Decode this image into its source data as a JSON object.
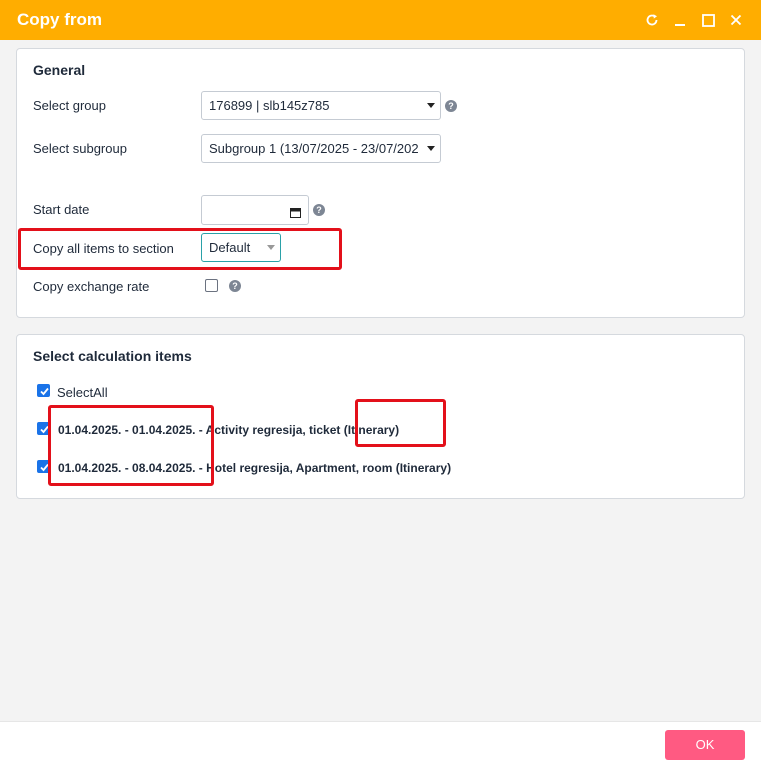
{
  "window": {
    "title": "Copy from",
    "controls": [
      "refresh-icon",
      "minimize-icon",
      "maximize-icon",
      "close-icon"
    ]
  },
  "general": {
    "heading": "General",
    "group_label": "Select group",
    "group_value": "176899 | slb145z785",
    "subgroup_label": "Select subgroup",
    "subgroup_value": "Subgroup 1 (13/07/2025 - 23/07/202",
    "start_date_label": "Start date",
    "start_date_value": "",
    "section_label": "Copy all items to section",
    "section_value": "Default",
    "exchange_label": "Copy exchange rate",
    "exchange_checked": false
  },
  "calc": {
    "heading": "Select calculation items",
    "select_all_label": "SelectAll",
    "select_all_checked": true,
    "items": [
      {
        "dates": "01.04.2025. - 01.04.2025.",
        "rest": " - Activity regresija, ticket",
        "suffix": " (Itinerary)",
        "checked": true
      },
      {
        "dates": "01.04.2025. - 08.04.2025.",
        "rest": " - Hotel regresija, Apartment, room (Itinerary)",
        "suffix": "",
        "checked": true
      }
    ]
  },
  "footer": {
    "ok_label": "OK"
  },
  "colors": {
    "titlebar": "#ffad00",
    "ok_button": "#ff5a82",
    "highlight": "#e3101a",
    "checkbox": "#1a73e8"
  }
}
